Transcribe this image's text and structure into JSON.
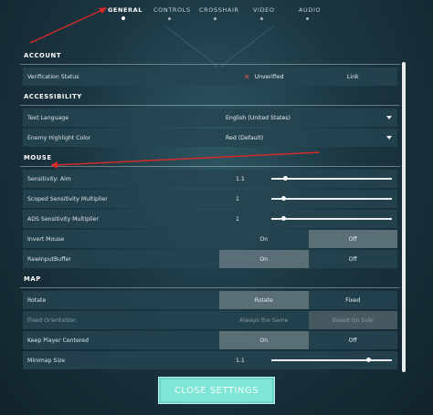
{
  "nav": {
    "tabs": [
      "GENERAL",
      "CONTROLS",
      "CROSSHAIR",
      "VIDEO",
      "AUDIO"
    ],
    "active": "GENERAL"
  },
  "sections": {
    "account": {
      "title": "ACCOUNT",
      "verification_label": "Verification Status",
      "verification_value": "Unverified",
      "link_label": "Link"
    },
    "accessibility": {
      "title": "ACCESSIBILITY",
      "text_language_label": "Text Language",
      "text_language_value": "English (United States)",
      "enemy_highlight_label": "Enemy Highlight Color",
      "enemy_highlight_value": "Red (Default)"
    },
    "mouse": {
      "title": "MOUSE",
      "sens_aim_label": "Sensitivity: Aim",
      "sens_aim_value": "1.1",
      "sens_aim_level": 0.11,
      "scoped_label": "Scoped Sensitivity Multiplier",
      "scoped_value": "1",
      "scoped_level": 0.1,
      "ads_label": "ADS Sensitivity Multiplier",
      "ads_value": "1",
      "ads_level": 0.1,
      "invert_label": "Invert Mouse",
      "invert_on": "On",
      "invert_off": "Off",
      "raw_label": "RawInputBuffer",
      "raw_on": "On",
      "raw_off": "Off"
    },
    "map": {
      "title": "MAP",
      "rotate_label": "Rotate",
      "rotate_opt1": "Rotate",
      "rotate_opt2": "Fixed",
      "fixed_orient_label": "Fixed Orientation",
      "fixed_orient_opt1": "Always the Same",
      "fixed_orient_opt2": "Based On Side",
      "keep_centered_label": "Keep Player Centered",
      "keep_on": "On",
      "keep_off": "Off",
      "minimap_label": "Minimap Size",
      "minimap_value": "1.1",
      "minimap_level": 0.8
    }
  },
  "close_button": "CLOSE SETTINGS",
  "colors": {
    "accent": "#7fe5d6",
    "annotation_arrow": "#d42a2a",
    "unverified_x": "#e25a4a"
  }
}
